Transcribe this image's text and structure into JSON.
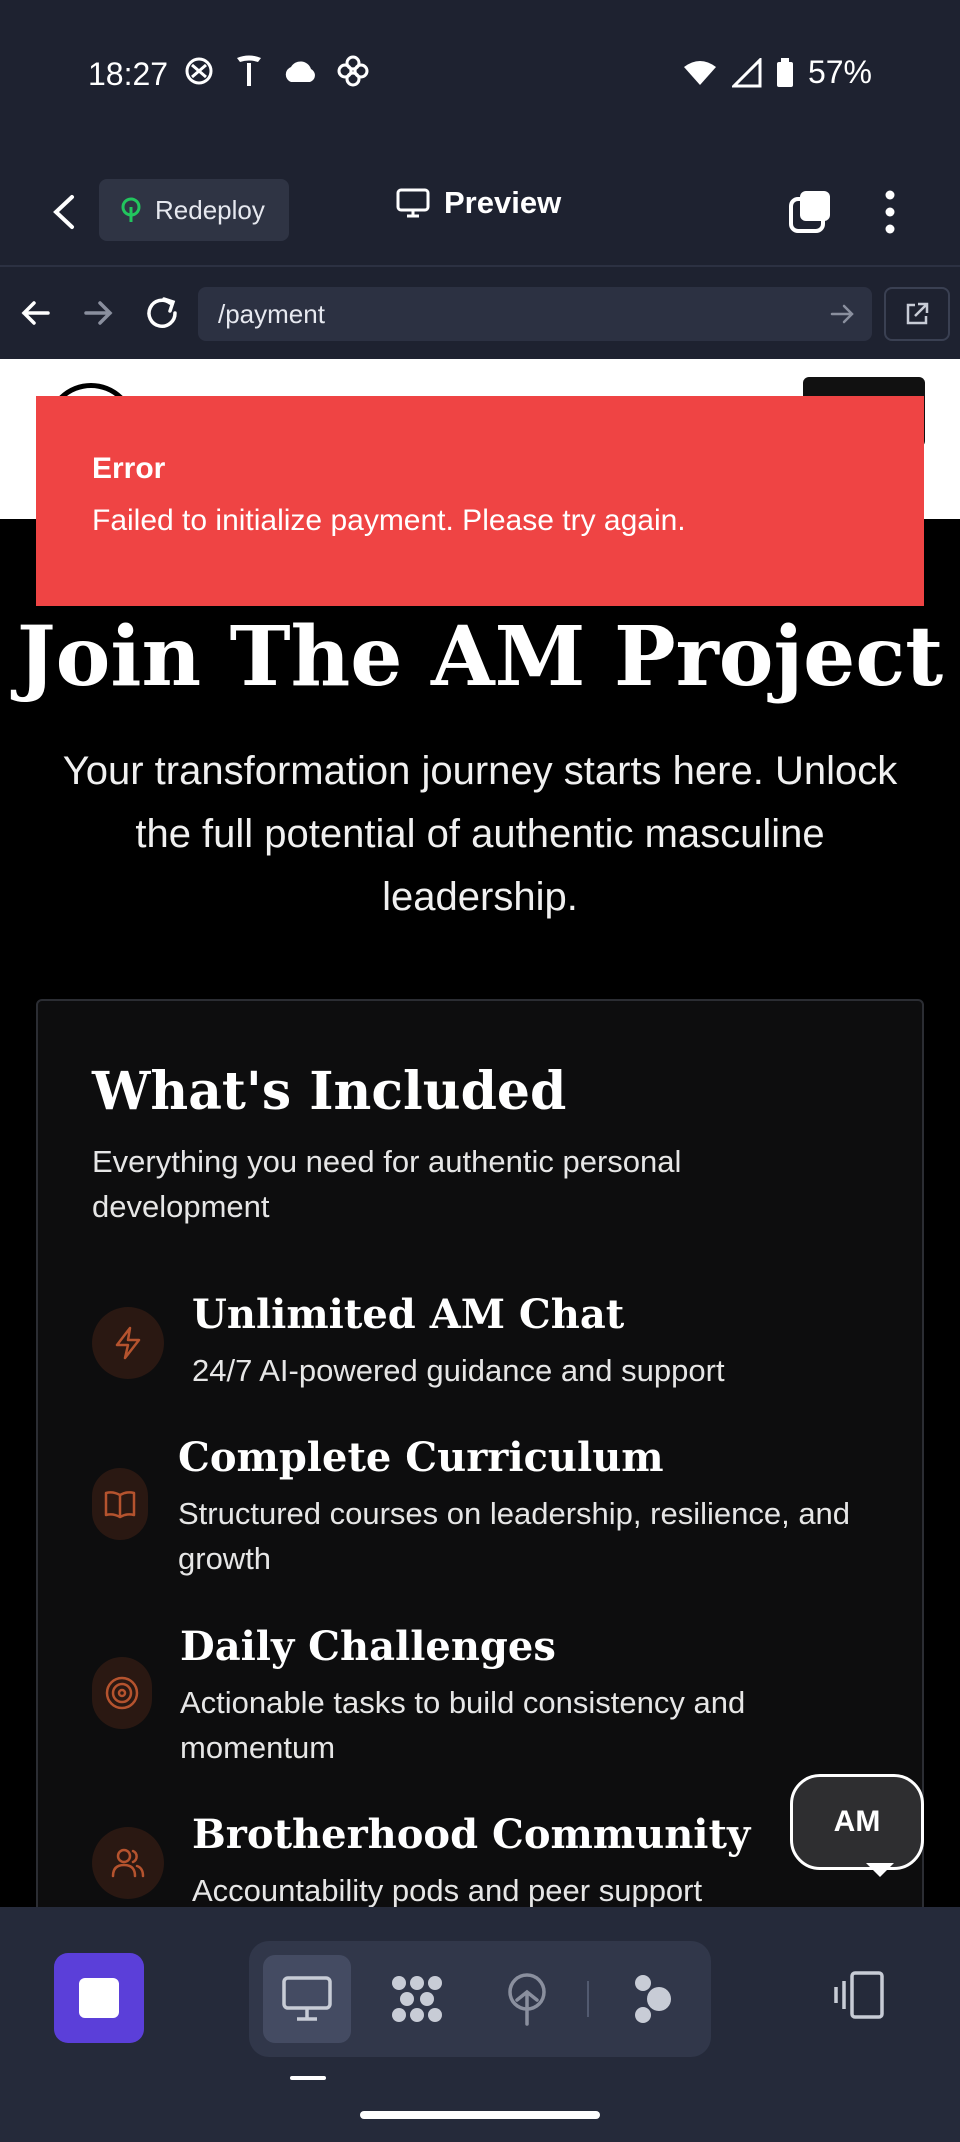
{
  "status_bar": {
    "time": "18:27",
    "battery": "57%"
  },
  "toolbar": {
    "redeploy_label": "Redeploy",
    "preview_label": "Preview"
  },
  "url_bar": {
    "path": "/payment"
  },
  "toast": {
    "title": "Error",
    "message": "Failed to initialize payment. Please try again."
  },
  "hero": {
    "title": "Join The AM Project",
    "subtitle": "Your transformation journey starts here. Unlock the full potential of authentic masculine leadership."
  },
  "included": {
    "title": "What's Included",
    "subtitle": "Everything you need for authentic personal development",
    "features": [
      {
        "title": "Unlimited AM Chat",
        "desc": "24/7 AI-powered guidance and support",
        "icon": "lightning-icon"
      },
      {
        "title": "Complete Curriculum",
        "desc": "Structured courses on leadership, resilience, and growth",
        "icon": "book-icon"
      },
      {
        "title": "Daily Challenges",
        "desc": "Actionable tasks to build consistency and momentum",
        "icon": "target-icon"
      },
      {
        "title": "Brotherhood Community",
        "desc": "Accountability pods and peer support",
        "icon": "users-icon"
      }
    ]
  },
  "chat_bubble": {
    "label": "AM"
  },
  "colors": {
    "accent": "#5b3fd9",
    "error": "#ef4444",
    "icon_accent": "#b5532e",
    "redeploy_icon": "#22c55e"
  }
}
